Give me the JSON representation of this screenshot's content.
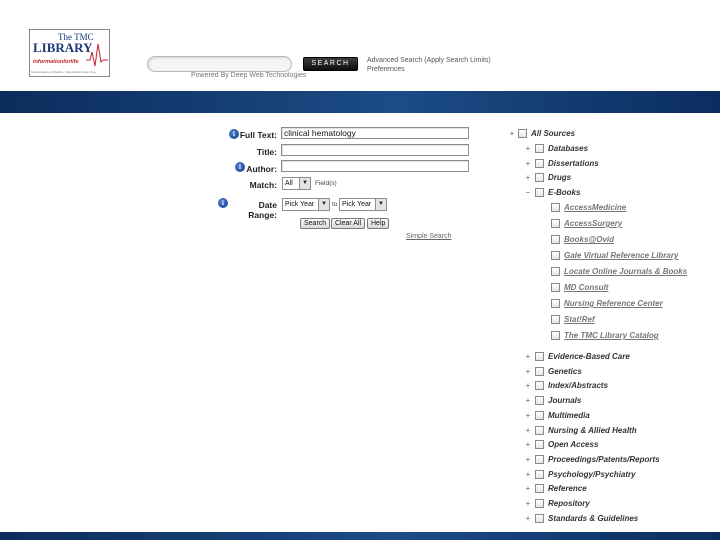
{
  "header": {
    "logo": {
      "line1": "The TMC",
      "line2": "LIBRARY",
      "tagline": "informationforlife",
      "subtext": "Houston Academy of Medicine - Texas Medical Center Library"
    },
    "search": {
      "value": "",
      "button_label": "SEARCH",
      "powered_by": "Powered By Deep Web Technologies"
    },
    "links": {
      "advanced": "Advanced Search (Apply Search Limits)",
      "preferences": "Preferences"
    }
  },
  "form": {
    "full_text": {
      "label": "Full Text:",
      "value": "clinical hematology"
    },
    "title": {
      "label": "Title:",
      "value": ""
    },
    "author": {
      "label": "Author:",
      "value": ""
    },
    "match": {
      "label": "Match:",
      "selected": "All",
      "suffix": "Field(s)"
    },
    "date_range": {
      "label": "Date Range:",
      "from": "Pick Year",
      "to_text": "to",
      "to": "Pick Year"
    },
    "buttons": {
      "search": "Search",
      "clear_all": "Clear All",
      "help": "Help"
    },
    "simple_search": "Simple Search"
  },
  "sources": {
    "root": "All Sources",
    "categories": [
      "Databases",
      "Dissertations",
      "Drugs",
      "E-Books",
      "Evidence-Based Care",
      "Genetics",
      "Index/Abstracts",
      "Journals",
      "Multimedia",
      "Nursing & Allied Health",
      "Open Access",
      "Proceedings/Patents/Reports",
      "Psychology/Psychiatry",
      "Reference",
      "Repository",
      "Standards & Guidelines"
    ],
    "expanded_category": "E-Books",
    "ebooks": [
      "AccessMedicine",
      "AccessSurgery",
      "Books@Ovid",
      "Gale Virtual Reference Library",
      "Locate Online Journals & Books",
      "MD Consult",
      "Nursing Reference Center",
      "Stat!Ref",
      "The TMC Library Catalog"
    ]
  }
}
